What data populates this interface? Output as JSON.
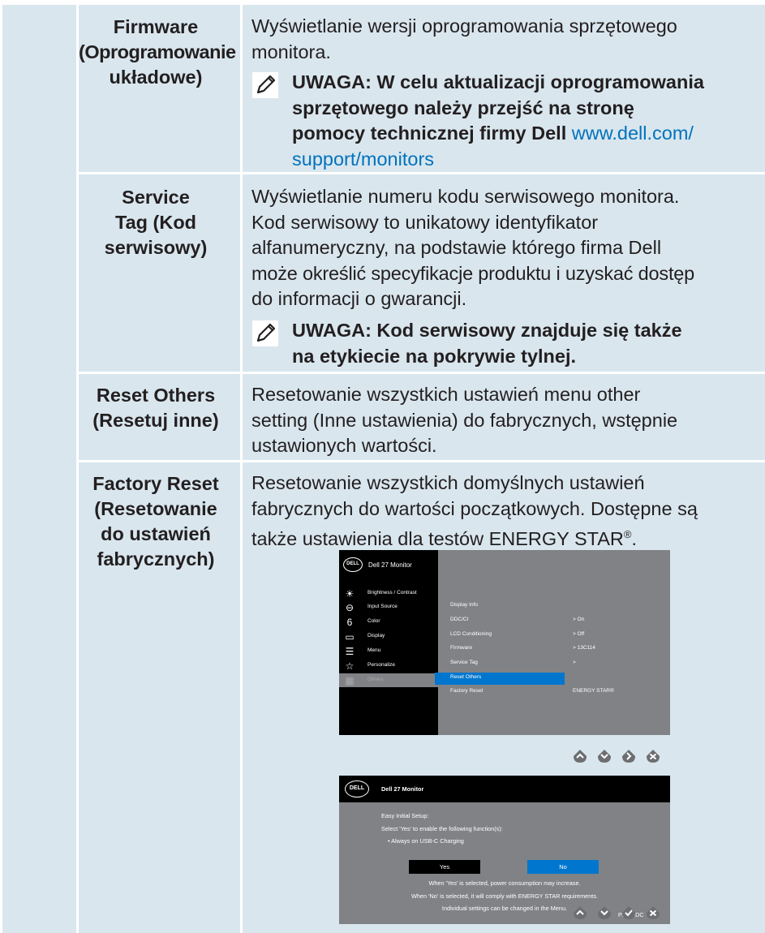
{
  "rows": {
    "firmware": {
      "label_lines": [
        "Firmware",
        "(Oprogramowanie",
        "układowe)"
      ],
      "desc_lines": [
        "Wyświetlanie wersji oprogramowania sprzętowego",
        "monitora."
      ],
      "note_lines": [
        "UWAGA: W celu aktualizacji oprogramowania",
        "sprzętowego należy przejść na stronę",
        "pomocy technicznej firmy Dell"
      ],
      "note_link_1": "www.dell.com/",
      "note_link_2": "support/monitors"
    },
    "service_tag": {
      "label_lines": [
        "Service",
        "Tag (Kod",
        "serwisowy)"
      ],
      "desc_lines": [
        "Wyświetlanie numeru kodu serwisowego monitora.",
        "Kod serwisowy to unikatowy identyfikator",
        "alfanumeryczny, na podstawie którego firma Dell",
        "może określić specyfikacje produktu i uzyskać dostęp",
        "do informacji o gwarancji."
      ],
      "note_lines": [
        "UWAGA: Kod serwisowy znajduje się także",
        "na etykiecie na pokrywie tylnej."
      ]
    },
    "reset_others": {
      "label_lines": [
        "Reset Others",
        "(Resetuj inne)"
      ],
      "desc_lines": [
        "Resetowanie wszystkich ustawień menu other",
        "setting (Inne ustawienia) do fabrycznych, wstępnie",
        "ustawionych wartości."
      ]
    },
    "factory_reset": {
      "label_lines": [
        "Factory Reset",
        "(Resetowanie",
        "do ustawień",
        "fabrycznych)"
      ],
      "desc_lines": [
        "Resetowanie wszystkich domyślnych ustawień",
        "fabrycznych do wartości początkowych. Dostępne są"
      ],
      "desc_line3": "także ustawienia dla testów ENERGY STAR",
      "desc_reg": "®",
      "desc_end": "."
    }
  },
  "osd_menu": {
    "logo": "DELL",
    "title": "Dell 27 Monitor",
    "menu_items": [
      {
        "label": "Brightness / Contrast",
        "icon": "brightness-icon"
      },
      {
        "label": "Input Source",
        "icon": "input-source-icon"
      },
      {
        "label": "Color",
        "icon": "color-icon"
      },
      {
        "label": "Display",
        "icon": "display-icon"
      },
      {
        "label": "Menu",
        "icon": "menu-icon"
      },
      {
        "label": "Personalize",
        "icon": "star-icon"
      },
      {
        "label": "Others",
        "icon": "others-icon"
      }
    ],
    "right_items": [
      "Display Info",
      "DDC/CI",
      "LCD Conditioning",
      "Firmware",
      "Service Tag",
      "Reset Others",
      "Factory Reset"
    ],
    "right_values": [
      "",
      "> On",
      "> Off",
      "> 13C114",
      ">",
      "",
      "ENERGY STAR®"
    ]
  },
  "osd_dialog": {
    "logo": "DELL",
    "title": "Dell 27 Monitor",
    "lines": [
      "Easy Initial Setup:",
      "Select 'Yes' to enable the following function(s):",
      "• Always on USB-C Charging"
    ],
    "yes_label": "Yes",
    "no_label": "No",
    "info_lines": [
      "When 'Yes' is selected, power consumption may increase.",
      "When 'No' is selected, it will comply with ENERGY STAR requirements.",
      "Individual settings can be changed in the Menu."
    ],
    "model": "P2720DC"
  },
  "colors": {
    "page_bg": "#d9e6ee",
    "link": "#0072bc",
    "osd_select": "#0076ce",
    "osd_gray": "#808285"
  }
}
